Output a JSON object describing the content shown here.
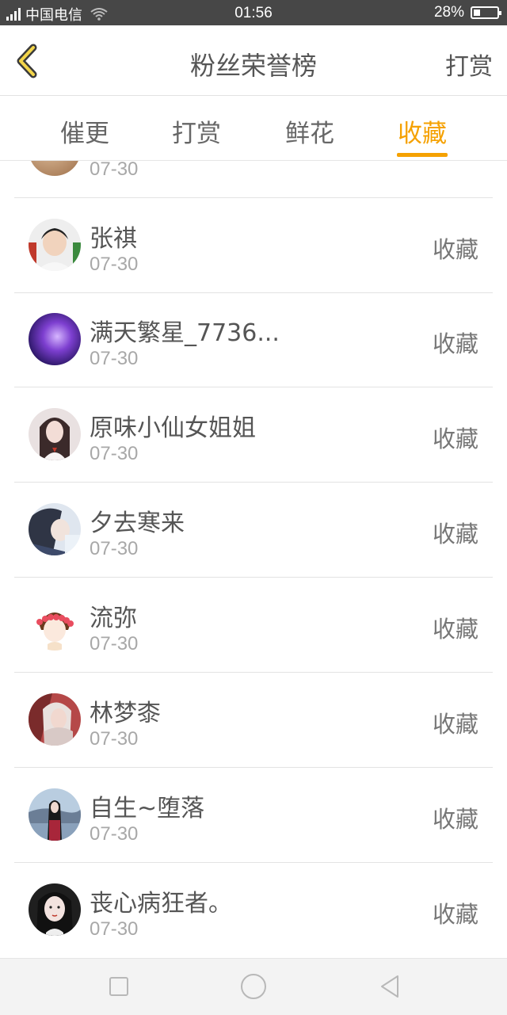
{
  "status_bar": {
    "network": "4G",
    "carrier": "中国电信",
    "time": "01:56",
    "battery": "28%",
    "battery_level": 0.28
  },
  "header": {
    "back_icon": "chevron-left-icon",
    "title": "粉丝荣誉榜",
    "action_label": "打赏"
  },
  "tabs": [
    {
      "label": "催更",
      "active": false
    },
    {
      "label": "打赏",
      "active": false
    },
    {
      "label": "鲜花",
      "active": false
    },
    {
      "label": "收藏",
      "active": true
    }
  ],
  "colors": {
    "accent": "#f5a100",
    "statusbar": "#474747",
    "text": "#555555",
    "subtext": "#a8a8a8"
  },
  "fans": [
    {
      "name": "",
      "date": "07-30",
      "action": ""
    },
    {
      "name": "张祺",
      "date": "07-30",
      "action": "收藏"
    },
    {
      "name": "满天繁星_7736...",
      "date": "07-30",
      "action": "收藏"
    },
    {
      "name": "原味小仙女姐姐",
      "date": "07-30",
      "action": "收藏"
    },
    {
      "name": "夕去寒来",
      "date": "07-30",
      "action": "收藏"
    },
    {
      "name": "流弥",
      "date": "07-30",
      "action": "收藏"
    },
    {
      "name": "林梦桼",
      "date": "07-30",
      "action": "收藏"
    },
    {
      "name": "自生~堕落",
      "date": "07-30",
      "action": "收藏"
    },
    {
      "name": "丧心病狂者。",
      "date": "07-30",
      "action": "收藏"
    }
  ],
  "nav_bar": {
    "recent_icon": "square-icon",
    "home_icon": "circle-icon",
    "back_icon": "triangle-back-icon"
  }
}
